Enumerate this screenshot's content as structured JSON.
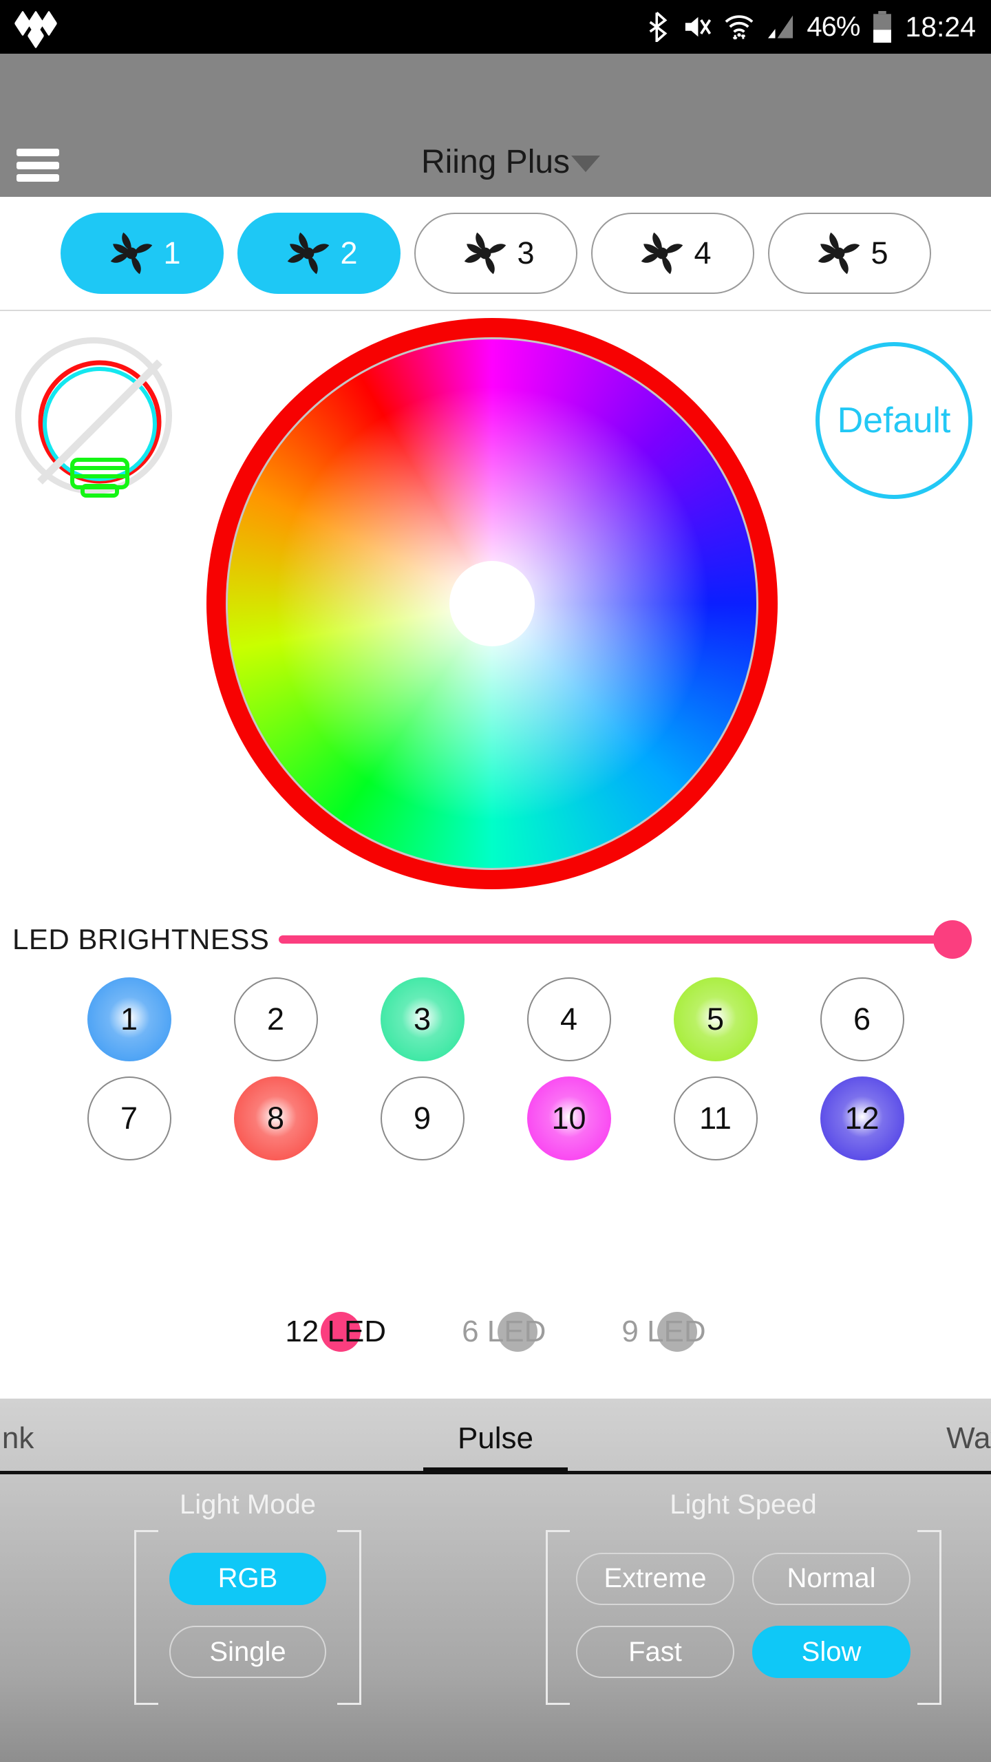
{
  "status_bar": {
    "app_logo": "tidal-logo-icon",
    "icons": [
      "bluetooth-icon",
      "mute-icon",
      "wifi-icon",
      "cellular-signal-icon"
    ],
    "battery_percent": "46%",
    "battery_icon": "battery-icon",
    "clock": "18:24"
  },
  "header": {
    "menu_icon": "hamburger-menu-icon",
    "title": "Riing Plus",
    "dropdown_icon": "chevron-down-icon"
  },
  "fan_tabs": [
    {
      "label": "1",
      "selected": true
    },
    {
      "label": "2",
      "selected": true
    },
    {
      "label": "3",
      "selected": false
    },
    {
      "label": "4",
      "selected": false
    },
    {
      "label": "5",
      "selected": false
    }
  ],
  "color_picker": {
    "bulb_off_icon": "light-bulb-off-icon",
    "default_button": "Default",
    "wheel_ring_color": "#f70202",
    "accent_color": "#22c8f5"
  },
  "brightness": {
    "label": "LED BRIGHTNESS",
    "value": 100,
    "color": "#fb3e7f"
  },
  "leds": [
    {
      "label": "1",
      "color": "#4da3f5",
      "filled": true
    },
    {
      "label": "2",
      "color": "",
      "filled": false
    },
    {
      "label": "3",
      "color": "#3fe8a5",
      "filled": true
    },
    {
      "label": "4",
      "color": "",
      "filled": false
    },
    {
      "label": "5",
      "color": "#a9ee3e",
      "filled": true
    },
    {
      "label": "6",
      "color": "",
      "filled": false
    },
    {
      "label": "7",
      "color": "",
      "filled": false
    },
    {
      "label": "8",
      "color": "#fa5b55",
      "filled": true
    },
    {
      "label": "9",
      "color": "",
      "filled": false
    },
    {
      "label": "10",
      "color": "#fa49f2",
      "filled": true
    },
    {
      "label": "11",
      "color": "",
      "filled": false
    },
    {
      "label": "12",
      "color": "#5b4de8",
      "filled": true
    }
  ],
  "led_count": [
    {
      "label": "12 LED",
      "selected": true
    },
    {
      "label": "6 LED",
      "selected": false
    },
    {
      "label": "9 LED",
      "selected": false
    }
  ],
  "effect_tabs": [
    {
      "label": "Blink",
      "active": false
    },
    {
      "label": "Pulse",
      "active": true
    },
    {
      "label": "Wave",
      "active": false
    }
  ],
  "light_mode": {
    "title": "Light Mode",
    "options": [
      {
        "label": "RGB",
        "selected": true
      },
      {
        "label": "Single",
        "selected": false
      }
    ]
  },
  "light_speed": {
    "title": "Light Speed",
    "options": [
      {
        "label": "Extreme",
        "selected": false
      },
      {
        "label": "Normal",
        "selected": false
      },
      {
        "label": "Fast",
        "selected": false
      },
      {
        "label": "Slow",
        "selected": true
      }
    ]
  }
}
